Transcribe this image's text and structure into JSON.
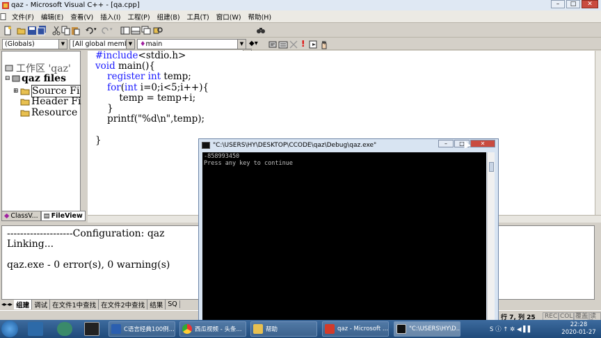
{
  "app": {
    "title": "qaz - Microsoft Visual C++ - [qa.cpp]"
  },
  "menu": [
    "文件(F)",
    "编辑(E)",
    "查看(V)",
    "插入(I)",
    "工程(P)",
    "组建(B)",
    "工具(T)",
    "窗口(W)",
    "帮助(H)"
  ],
  "toolbar2": {
    "globals": "(Globals)",
    "members": "[All global members",
    "func": "main"
  },
  "workspace": {
    "root": "工作区 'qaz'",
    "project": "qaz files",
    "folders": [
      "Source Fi",
      "Header Fi",
      "Resource"
    ],
    "tabs": [
      "ClassV...",
      "FileView"
    ]
  },
  "code_lines": [
    "#include<stdio.h>",
    "void main(){",
    "    register int temp;",
    "    for(int i=0;i<5;i++){",
    "        temp = temp+i;",
    "    }",
    "    printf(\"%d\\n\",temp);",
    "",
    "}"
  ],
  "output": {
    "lines": [
      "--------------------Configuration: qaz",
      "Linking...",
      "",
      "qaz.exe - 0 error(s), 0 warning(s)"
    ],
    "tabs": [
      "组建",
      "调试",
      "在文件1中查找",
      "在文件2中查找",
      "结果",
      "SQ"
    ]
  },
  "status": {
    "position": "行 7, 列 25",
    "indicators": [
      "REC",
      "COL",
      "覆盖",
      "读取"
    ]
  },
  "console": {
    "title": "\"C:\\USERS\\HY\\DESKTOP\\CCODE\\qaz\\Debug\\qaz.exe\"",
    "lines": [
      "-858993450",
      "Press any key to continue"
    ]
  },
  "taskbar": {
    "buttons": [
      "C语言经典100例...",
      "西瓜视频 - 头条...",
      "帮助",
      "qaz - Microsoft ...",
      "\"C:\\USERS\\HY\\D..."
    ],
    "clock_time": "22:28",
    "clock_date": "2020-01-27"
  },
  "colors": {
    "keyword": "#1a1aff",
    "console_bg": "#000000",
    "taskbar": "#1f4a7a"
  }
}
